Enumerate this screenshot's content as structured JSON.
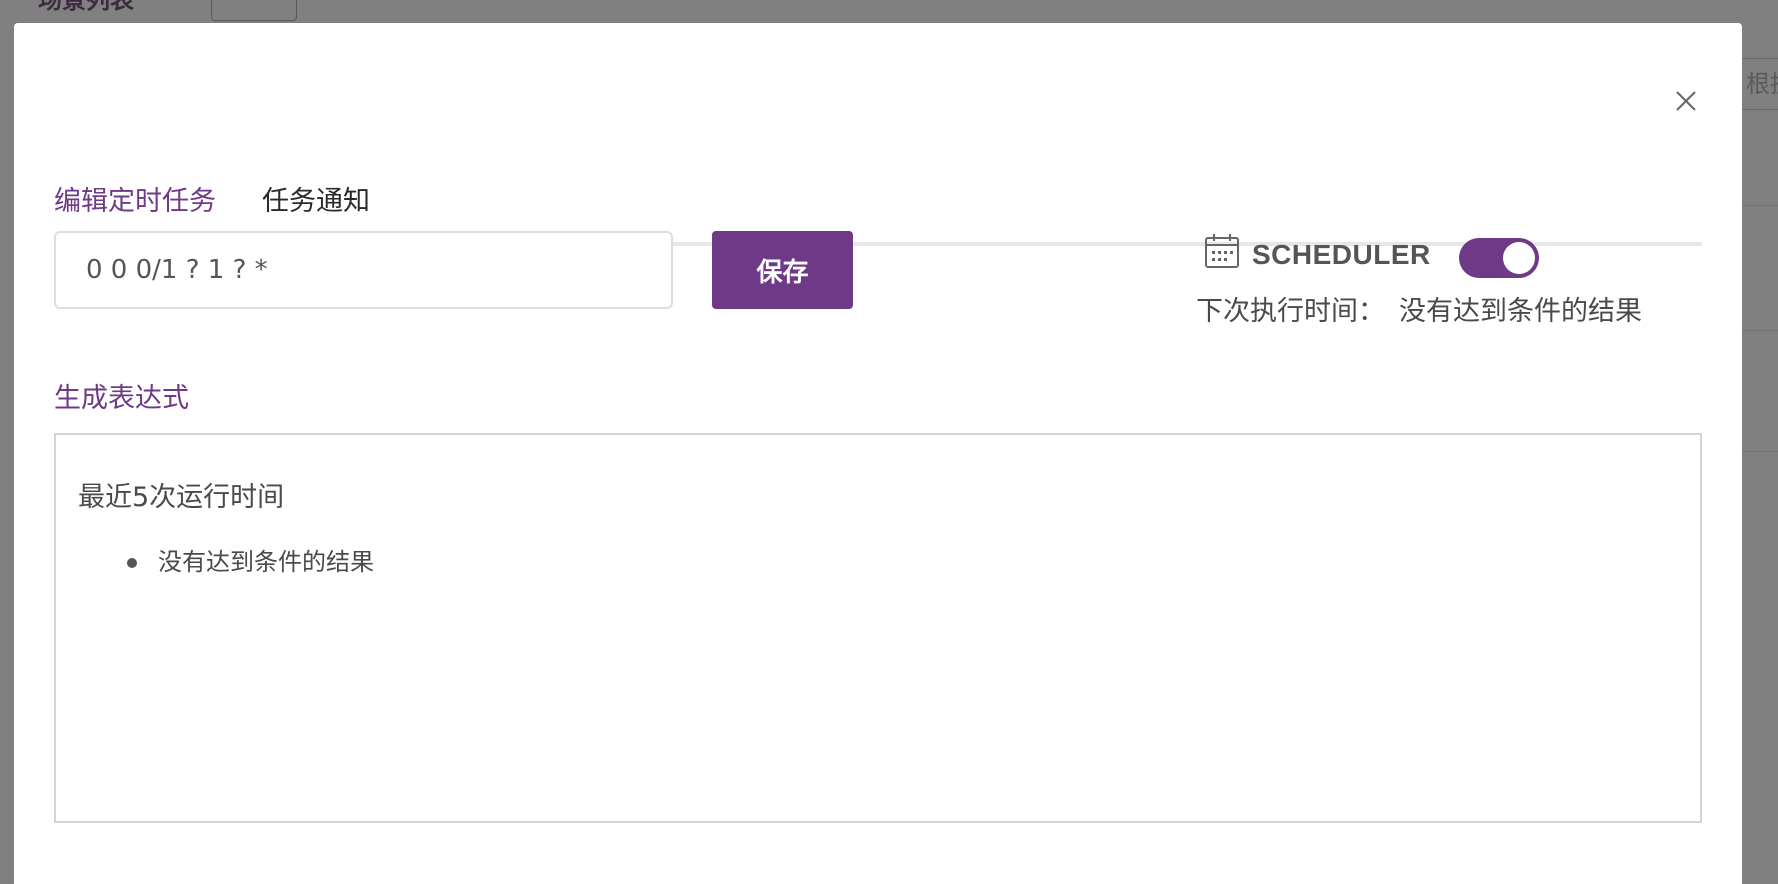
{
  "background": {
    "header_title": "场景列表",
    "add_button_label": "+",
    "right_input_text": "根据"
  },
  "modal": {
    "close_icon": "close-icon",
    "tabs": [
      {
        "label": "编辑定时任务",
        "active": true
      },
      {
        "label": "任务通知",
        "active": false
      }
    ],
    "cron_input": {
      "value": "0 0 0/1 ? 1 ? *",
      "placeholder": ""
    },
    "save_button_label": "保存",
    "scheduler": {
      "icon": "calendar-icon",
      "label": "SCHEDULER",
      "enabled": true,
      "next_run_label": "下次执行时间：",
      "next_run_value": "没有达到条件的结果"
    },
    "generate_expression_label": "生成表达式",
    "recent_runs": {
      "title": "最近5次运行时间",
      "items": [
        "没有达到条件的结果"
      ]
    }
  },
  "colors": {
    "accent": "#6e3a87",
    "overlay": "#808080",
    "text": "#4a4a4a"
  }
}
